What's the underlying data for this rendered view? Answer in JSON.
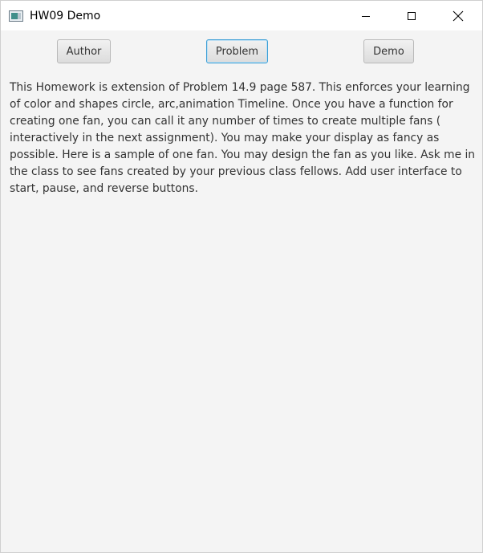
{
  "window": {
    "title": "HW09 Demo",
    "icon": "java-app-icon",
    "controls": {
      "minimize_icon": "minimize-icon",
      "maximize_icon": "maximize-icon",
      "close_icon": "close-icon"
    }
  },
  "toolbar": {
    "author_label": "Author",
    "problem_label": "Problem",
    "demo_label": "Demo"
  },
  "content": {
    "description": "This Homework is extension of Problem 14.9 page 587. This enforces your learning of color and shapes circle, arc,animation Timeline. Once you have a function for creating one fan, you can call it any number of times to create multiple fans  ( interactively in the next assignment). You may make your display as fancy as possible. Here is a sample of one fan. You may design the fan as you like. Ask me in the class to see fans created by your previous class fellows. Add user interface to start, pause, and reverse buttons."
  },
  "colors": {
    "background": "#f4f4f4",
    "titlebar": "#ffffff",
    "focus_border": "#3c9fd6"
  }
}
